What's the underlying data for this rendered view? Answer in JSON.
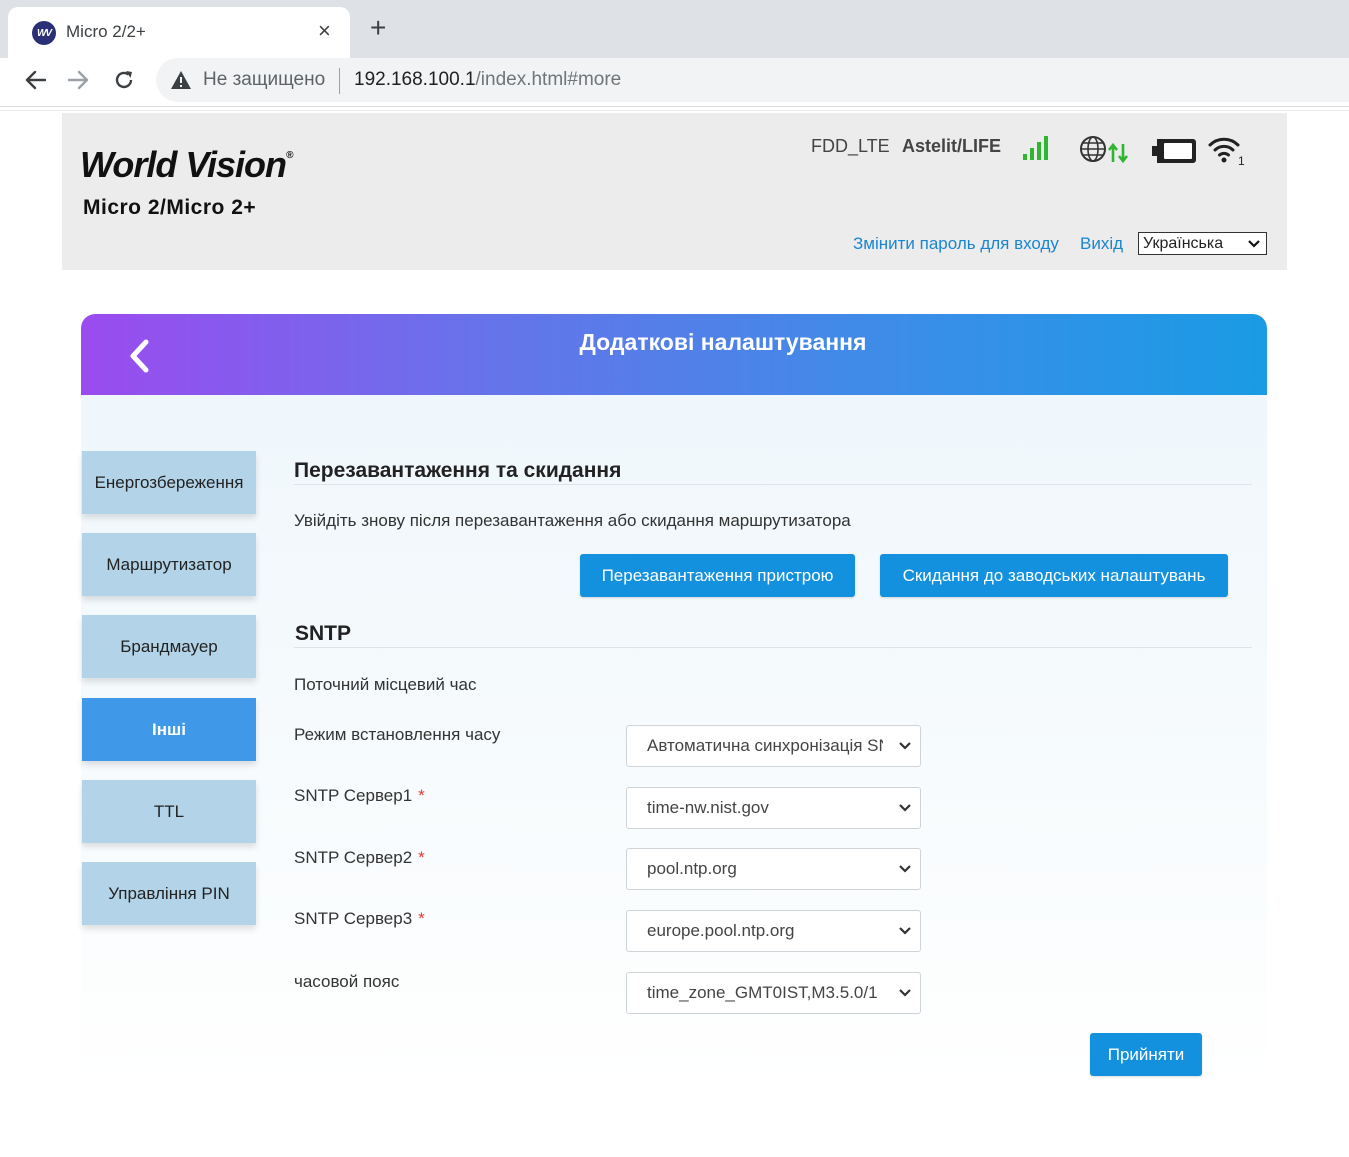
{
  "browser": {
    "tab_title": "Micro 2/2+",
    "favicon_text": "WV",
    "close_glyph": "×",
    "new_tab_glyph": "+",
    "insecure_label": "Не защищено",
    "url_host": "192.168.100.1",
    "url_path": "/index.html#more"
  },
  "header": {
    "brand": "World Vision",
    "brand_mark": "®",
    "model": "Micro 2/Micro 2+",
    "network_type": "FDD_LTE",
    "operator": "Astelit/LIFE",
    "wifi_clients": "1",
    "change_password_link": "Змінити пароль для входу",
    "logout_link": "Вихід",
    "language": "Українська"
  },
  "panel": {
    "title": "Додаткові налаштування"
  },
  "sidebar": {
    "items": [
      {
        "label": "Енергозбереження"
      },
      {
        "label": "Маршрутизатор"
      },
      {
        "label": "Брандмауер"
      },
      {
        "label": "Інші",
        "active": true
      },
      {
        "label": "TTL"
      },
      {
        "label": "Управління PIN"
      }
    ]
  },
  "reboot": {
    "title": "Перезавантаження та скидання",
    "description": "Увійдіть знову після перезавантаження або скидання маршрутизатора",
    "reboot_button": "Перезавантаження пристрою",
    "reset_button": "Скидання до заводських налаштувань"
  },
  "sntp": {
    "title": "SNTP",
    "local_time_label": "Поточний місцевий час",
    "mode_label": "Режим встановлення часу",
    "mode_value": "Автоматична синхронізація SNTP",
    "server1_label": "SNTP Сервер1",
    "server1_value": "time-nw.nist.gov",
    "server2_label": "SNTP Сервер2",
    "server2_value": "pool.ntp.org",
    "server3_label": "SNTP Сервер3",
    "server3_value": "europe.pool.ntp.org",
    "timezone_label": "часовой пояс",
    "timezone_value": "time_zone_GMT0IST,M3.5.0/1",
    "required_mark": "*",
    "apply_button": "Прийняти"
  },
  "colors": {
    "accent": "#1491de",
    "sidebar_bg": "#b3d4e8",
    "sidebar_active": "#3f99e8",
    "link": "#1a86d0",
    "signal_green": "#2fb52f"
  }
}
